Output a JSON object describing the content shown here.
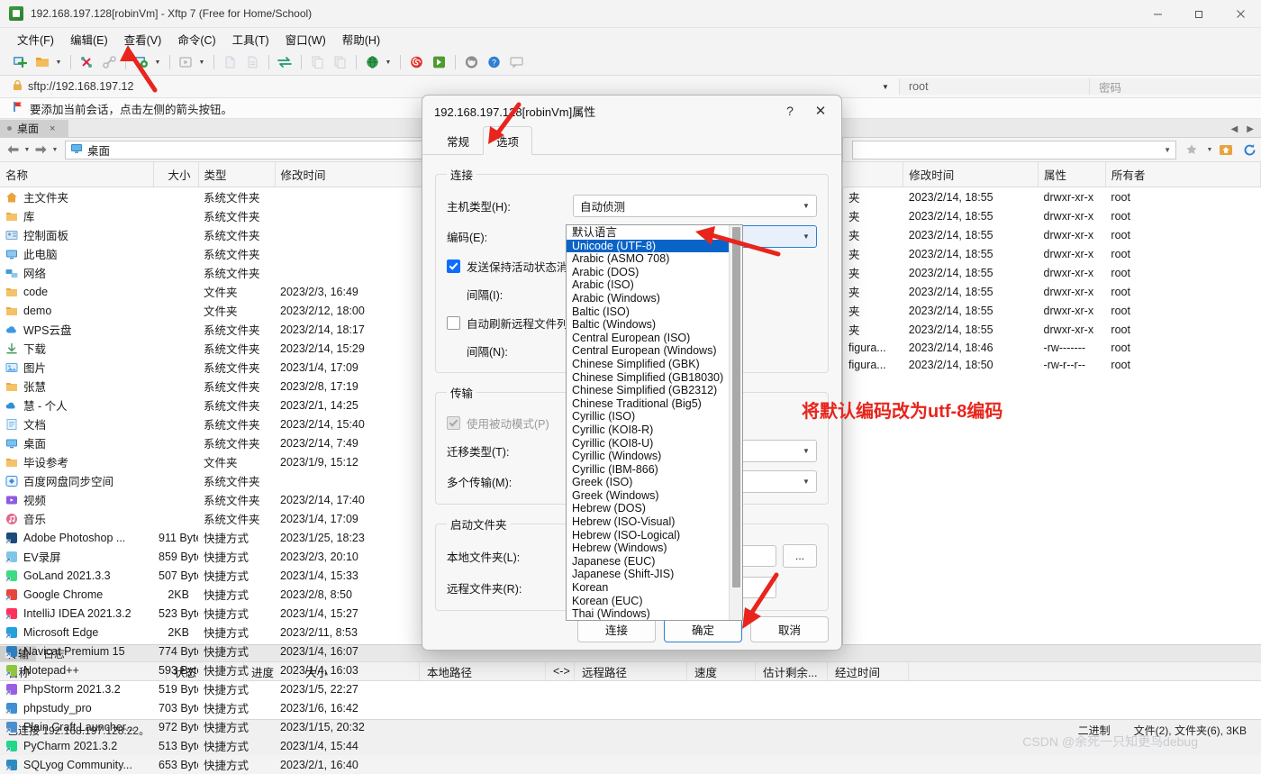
{
  "window": {
    "title": "192.168.197.128[robinVm] - Xftp 7 (Free for Home/School)",
    "app_icon": "xftp-icon",
    "minimize": "—",
    "maximize": "❐",
    "close": "✕"
  },
  "menu": [
    "文件(F)",
    "编辑(E)",
    "查看(V)",
    "命令(C)",
    "工具(T)",
    "窗口(W)",
    "帮助(H)"
  ],
  "address": {
    "url": "sftp://192.168.197.12",
    "user": "root",
    "password_placeholder": "密码"
  },
  "hint": "要添加当前会话，点击左侧的箭头按钮。",
  "tabs": [
    {
      "label": "桌面",
      "close": "×"
    }
  ],
  "left_pane": {
    "path": "桌面",
    "columns": [
      "名称",
      "大小",
      "类型",
      "修改时间"
    ],
    "rows": [
      {
        "name": "主文件夹",
        "size": "",
        "type": "系统文件夹",
        "mtime": "",
        "icon": "home-icon",
        "color": "#e8a33d"
      },
      {
        "name": "库",
        "size": "",
        "type": "系统文件夹",
        "mtime": "",
        "icon": "folder-icon",
        "color": "#f5c268"
      },
      {
        "name": "控制面板",
        "size": "",
        "type": "系统文件夹",
        "mtime": "",
        "icon": "control-panel-icon",
        "color": "#6fa8dc"
      },
      {
        "name": "此电脑",
        "size": "",
        "type": "系统文件夹",
        "mtime": "",
        "icon": "computer-icon",
        "color": "#3d8fd1"
      },
      {
        "name": "网络",
        "size": "",
        "type": "系统文件夹",
        "mtime": "",
        "icon": "network-icon",
        "color": "#4a9bd4"
      },
      {
        "name": "code",
        "size": "",
        "type": "文件夹",
        "mtime": "2023/2/3, 16:49",
        "icon": "folder-icon",
        "color": "#f5c268"
      },
      {
        "name": "demo",
        "size": "",
        "type": "文件夹",
        "mtime": "2023/2/12, 18:00",
        "icon": "folder-icon",
        "color": "#f5c268"
      },
      {
        "name": "WPS云盘",
        "size": "",
        "type": "系统文件夹",
        "mtime": "2023/2/14, 18:17",
        "icon": "cloud-icon",
        "color": "#3b97e3"
      },
      {
        "name": "下载",
        "size": "",
        "type": "系统文件夹",
        "mtime": "2023/2/14, 15:29",
        "icon": "download-icon",
        "color": "#4a9b5e"
      },
      {
        "name": "图片",
        "size": "",
        "type": "系统文件夹",
        "mtime": "2023/1/4, 17:09",
        "icon": "picture-icon",
        "color": "#5aa9e6"
      },
      {
        "name": "张慧",
        "size": "",
        "type": "系统文件夹",
        "mtime": "2023/2/8, 17:19",
        "icon": "folder-icon",
        "color": "#f5c268"
      },
      {
        "name": "慧 - 个人",
        "size": "",
        "type": "系统文件夹",
        "mtime": "2023/2/1, 14:25",
        "icon": "onedrive-icon",
        "color": "#2f8fd8"
      },
      {
        "name": "文档",
        "size": "",
        "type": "系统文件夹",
        "mtime": "2023/2/14, 15:40",
        "icon": "document-icon",
        "color": "#7ab6e8"
      },
      {
        "name": "桌面",
        "size": "",
        "type": "系统文件夹",
        "mtime": "2023/2/14, 7:49",
        "icon": "desktop-icon",
        "color": "#3d8fd1"
      },
      {
        "name": "毕设参考",
        "size": "",
        "type": "文件夹",
        "mtime": "2023/1/9, 15:12",
        "icon": "folder-icon",
        "color": "#f5c268"
      },
      {
        "name": "百度网盘同步空间",
        "size": "",
        "type": "系统文件夹",
        "mtime": "",
        "icon": "baidu-icon",
        "color": "#3b8ddd"
      },
      {
        "name": "视频",
        "size": "",
        "type": "系统文件夹",
        "mtime": "2023/2/14, 17:40",
        "icon": "video-icon",
        "color": "#8e5ae0"
      },
      {
        "name": "音乐",
        "size": "",
        "type": "系统文件夹",
        "mtime": "2023/1/4, 17:09",
        "icon": "music-icon",
        "color": "#e06b8e"
      },
      {
        "name": "Adobe Photoshop ...",
        "size": "911 Bytes",
        "type": "快捷方式",
        "mtime": "2023/1/25, 18:23",
        "icon": "photoshop-icon",
        "color": "#1d4b78"
      },
      {
        "name": "EV录屏",
        "size": "859 Bytes",
        "type": "快捷方式",
        "mtime": "2023/2/3, 20:10",
        "icon": "evcapture-icon",
        "color": "#7fc6e8"
      },
      {
        "name": "GoLand 2021.3.3",
        "size": "507 Bytes",
        "type": "快捷方式",
        "mtime": "2023/1/4, 15:33",
        "icon": "goland-icon",
        "color": "#3ddc84"
      },
      {
        "name": "Google Chrome",
        "size": "2KB",
        "type": "快捷方式",
        "mtime": "2023/2/8, 8:50",
        "icon": "chrome-icon",
        "color": "#e8453c"
      },
      {
        "name": "IntelliJ IDEA 2021.3.2",
        "size": "523 Bytes",
        "type": "快捷方式",
        "mtime": "2023/1/4, 15:27",
        "icon": "intellij-icon",
        "color": "#fe315d"
      },
      {
        "name": "Microsoft Edge",
        "size": "2KB",
        "type": "快捷方式",
        "mtime": "2023/2/11, 8:53",
        "icon": "edge-icon",
        "color": "#25a0da"
      },
      {
        "name": "Navicat Premium 15",
        "size": "774 Bytes",
        "type": "快捷方式",
        "mtime": "2023/1/4, 16:07",
        "icon": "navicat-icon",
        "color": "#2c7fc0"
      },
      {
        "name": "Notepad++",
        "size": "593 Bytes",
        "type": "快捷方式",
        "mtime": "2023/1/4, 16:03",
        "icon": "notepadpp-icon",
        "color": "#8ec63f"
      },
      {
        "name": "PhpStorm 2021.3.2",
        "size": "519 Bytes",
        "type": "快捷方式",
        "mtime": "2023/1/5, 22:27",
        "icon": "phpstorm-icon",
        "color": "#9b5de5"
      },
      {
        "name": "phpstudy_pro",
        "size": "703 Bytes",
        "type": "快捷方式",
        "mtime": "2023/1/6, 16:42",
        "icon": "phpstudy-icon",
        "color": "#3f8fd0"
      },
      {
        "name": "Plain Craft Launcher...",
        "size": "972 Bytes",
        "type": "快捷方式",
        "mtime": "2023/1/15, 20:32",
        "icon": "launcher-icon",
        "color": "#4e8ed0"
      },
      {
        "name": "PyCharm 2021.3.2",
        "size": "513 Bytes",
        "type": "快捷方式",
        "mtime": "2023/1/4, 15:44",
        "icon": "pycharm-icon",
        "color": "#21d789"
      },
      {
        "name": "SQLyog Community...",
        "size": "653 Bytes",
        "type": "快捷方式",
        "mtime": "2023/2/1, 16:40",
        "icon": "sqlyog-icon",
        "color": "#2e8bc0"
      }
    ]
  },
  "right_pane": {
    "columns": [
      "修改时间",
      "属性",
      "所有者"
    ],
    "rows": [
      {
        "name": "夹",
        "mtime": "2023/2/14, 18:55",
        "attr": "drwxr-xr-x",
        "owner": "root"
      },
      {
        "name": "夹",
        "mtime": "2023/2/14, 18:55",
        "attr": "drwxr-xr-x",
        "owner": "root"
      },
      {
        "name": "夹",
        "mtime": "2023/2/14, 18:55",
        "attr": "drwxr-xr-x",
        "owner": "root"
      },
      {
        "name": "夹",
        "mtime": "2023/2/14, 18:55",
        "attr": "drwxr-xr-x",
        "owner": "root"
      },
      {
        "name": "夹",
        "mtime": "2023/2/14, 18:55",
        "attr": "drwxr-xr-x",
        "owner": "root"
      },
      {
        "name": "夹",
        "mtime": "2023/2/14, 18:55",
        "attr": "drwxr-xr-x",
        "owner": "root"
      },
      {
        "name": "夹",
        "mtime": "2023/2/14, 18:55",
        "attr": "drwxr-xr-x",
        "owner": "root"
      },
      {
        "name": "夹",
        "mtime": "2023/2/14, 18:55",
        "attr": "drwxr-xr-x",
        "owner": "root"
      },
      {
        "name": "figura...",
        "mtime": "2023/2/14, 18:46",
        "attr": "-rw-------",
        "owner": "root"
      },
      {
        "name": "figura...",
        "mtime": "2023/2/14, 18:50",
        "attr": "-rw-r--r--",
        "owner": "root"
      }
    ]
  },
  "transfer": {
    "tabs": [
      {
        "label": "传输",
        "active": true
      },
      {
        "label": "日志",
        "active": false
      }
    ],
    "columns": [
      "名称",
      "状态",
      "进度",
      "大小",
      "本地路径",
      "<->",
      "远程路径",
      "速度",
      "估计剩余...",
      "经过时间"
    ]
  },
  "status": {
    "connection": "已连接 192.168.197.128:22。",
    "mode": "二进制",
    "counts": "文件(2), 文件夹(6), 3KB"
  },
  "watermark": "CSDN @余死一只知更鸟debug",
  "dialog": {
    "title": "192.168.197.128[robinVm]属性",
    "help": "?",
    "close": "✕",
    "tabs": [
      {
        "label": "常规",
        "active": false
      },
      {
        "label": "选项",
        "active": true
      }
    ],
    "connection_group": "连接",
    "host_type_label": "主机类型(H):",
    "host_type_value": "自动侦测",
    "encoding_label": "编码(E):",
    "encoding_value": "默认语言",
    "keepalive_label": "发送保持活动状态消息(",
    "keepalive_checked": true,
    "interval_i_label": "间隔(I):",
    "autorefresh_label": "自动刷新远程文件列表(",
    "autorefresh_checked": false,
    "interval_n_label": "间隔(N):",
    "transfer_group": "传输",
    "passive_label": "使用被动模式(P)",
    "passive_checked": true,
    "migrate_type_label": "迁移类型(T):",
    "multi_transfer_label": "多个传输(M):",
    "startup_group": "启动文件夹",
    "local_folder_label": "本地文件夹(L):",
    "remote_folder_label": "远程文件夹(R):",
    "browse_label": "...",
    "buttons": [
      {
        "label": "连接",
        "default": false
      },
      {
        "label": "确定",
        "default": true
      },
      {
        "label": "取消",
        "default": false
      }
    ]
  },
  "encoding_dropdown": {
    "selected": "Unicode (UTF-8)",
    "items": [
      "默认语言",
      "Unicode (UTF-8)",
      "Arabic (ASMO 708)",
      "Arabic (DOS)",
      "Arabic (ISO)",
      "Arabic (Windows)",
      "Baltic (ISO)",
      "Baltic (Windows)",
      "Central European (ISO)",
      "Central European (Windows)",
      "Chinese Simplified (GBK)",
      "Chinese Simplified (GB18030)",
      "Chinese Simplified (GB2312)",
      "Chinese Traditional (Big5)",
      "Cyrillic (ISO)",
      "Cyrillic (KOI8-R)",
      "Cyrillic (KOI8-U)",
      "Cyrillic (Windows)",
      "Cyrillic (IBM-866)",
      "Greek (ISO)",
      "Greek (Windows)",
      "Hebrew (DOS)",
      "Hebrew (ISO-Visual)",
      "Hebrew (ISO-Logical)",
      "Hebrew (Windows)",
      "Japanese (EUC)",
      "Japanese (Shift-JIS)",
      "Korean",
      "Korean (EUC)",
      "Thai (Windows)"
    ]
  },
  "annotations": {
    "note": "将默认编码改为utf-8编码",
    "accent_color": "#e8251c"
  }
}
